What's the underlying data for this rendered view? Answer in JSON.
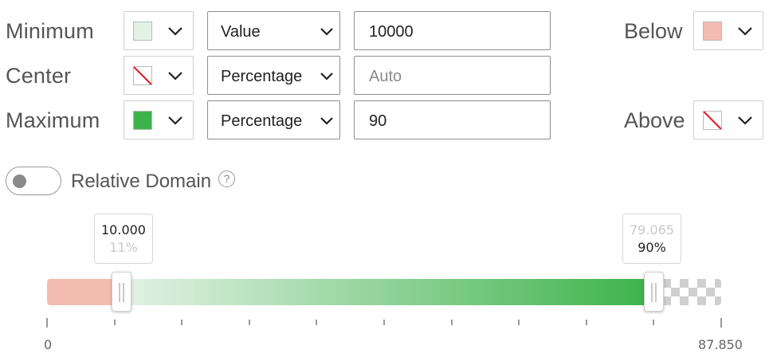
{
  "rows": [
    {
      "label": "Minimum",
      "swatch": "#e4f2e6",
      "swatch_none": false,
      "mode": "Value",
      "value": "10000",
      "placeholder": ""
    },
    {
      "label": "Center",
      "swatch": "",
      "swatch_none": true,
      "mode": "Percentage",
      "value": "",
      "placeholder": "Auto"
    },
    {
      "label": "Maximum",
      "swatch": "#3cb34a",
      "swatch_none": false,
      "mode": "Percentage",
      "value": "90",
      "placeholder": ""
    }
  ],
  "below": {
    "label": "Below",
    "swatch": "#f4bcb1"
  },
  "above": {
    "label": "Above",
    "swatch_none": true
  },
  "toggle": {
    "label": "Relative Domain",
    "on": false,
    "help": "?"
  },
  "slider": {
    "min_tip": {
      "value": "10.000",
      "percent": "11%"
    },
    "max_tip": {
      "value": "79.065",
      "percent": "90%"
    },
    "axis_min": "0",
    "axis_max": "87.850",
    "min_fraction": 0.11,
    "max_fraction": 0.9,
    "colors": {
      "below": "#f2bcb1",
      "grad_start": "#e4f2e6",
      "grad_end": "#3cb34a"
    }
  },
  "icons": {
    "dropdown": "chevron-down-icon",
    "none_swatch": "no-color-icon",
    "help": "help-circle-icon"
  }
}
